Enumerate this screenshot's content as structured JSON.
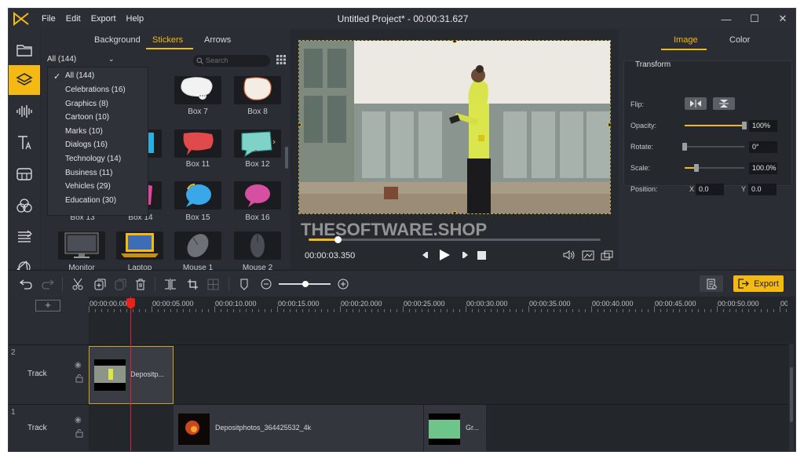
{
  "window": {
    "title": "Untitled Project* - 00:00:31.627",
    "menu": [
      "File",
      "Edit",
      "Export",
      "Help"
    ]
  },
  "library": {
    "tabs": [
      "Background",
      "Stickers",
      "Arrows"
    ],
    "active_tab": "Stickers",
    "category_selected": "All (144)",
    "search_placeholder": "Search",
    "categories": [
      "All (144)",
      "Celebrations (16)",
      "Graphics (8)",
      "Cartoon (10)",
      "Marks (10)",
      "Dialogs (16)",
      "Technology (14)",
      "Business (11)",
      "Vehicles (29)",
      "Education (30)"
    ],
    "visible_labels": {
      "r1c3": "Box 7",
      "r1c4": "Box 8",
      "r2c2": "0",
      "r2c3": "Box 11",
      "r2c4": "Box 12",
      "r3c1": "Box 13",
      "r3c2": "Box 14",
      "r3c3": "Box 15",
      "r3c4": "Box 16",
      "r4c1": "Monitor",
      "r4c2": "Laptop",
      "r4c3": "Mouse 1",
      "r4c4": "Mouse 2"
    }
  },
  "preview": {
    "watermark": "THESOFTWARE.SHOP",
    "current_time": "00:00:03.350",
    "progress": 0.1
  },
  "properties": {
    "tabs": [
      "Image",
      "Color"
    ],
    "active_tab": "Image",
    "section": "Transform",
    "flip_label": "Flip:",
    "opacity_label": "Opacity:",
    "opacity_value": "100%",
    "opacity_level": 1.0,
    "rotate_label": "Rotate:",
    "rotate_value": "0°",
    "rotate_level": 0.0,
    "scale_label": "Scale:",
    "scale_value": "100.0%",
    "scale_level": 0.2,
    "position_label": "Position:",
    "x_label": "X",
    "x_value": "0.0",
    "y_label": "Y",
    "y_value": "0.0"
  },
  "toolbar": {
    "export_label": "Export"
  },
  "timeline": {
    "ticks": [
      "00:00:00.000",
      "00:00:05.000",
      "00:00:10.000",
      "00:00:15.000",
      "00:00:20.000",
      "00:00:25.000",
      "00:00:30.000",
      "00:00:35.000",
      "00:00:40.000",
      "00:00:45.000",
      "00:00:50.000",
      "00:0("
    ],
    "tracks": [
      {
        "number": "2",
        "name": "Track",
        "clips": [
          "Depositp..."
        ]
      },
      {
        "number": "1",
        "name": "Track",
        "clips": [
          "Depositphotos_364425532_4k",
          "Gr..."
        ]
      }
    ]
  },
  "colors": {
    "accent": "#f4b912",
    "playhead": "#e8231b",
    "panel": "#2a2d33"
  }
}
